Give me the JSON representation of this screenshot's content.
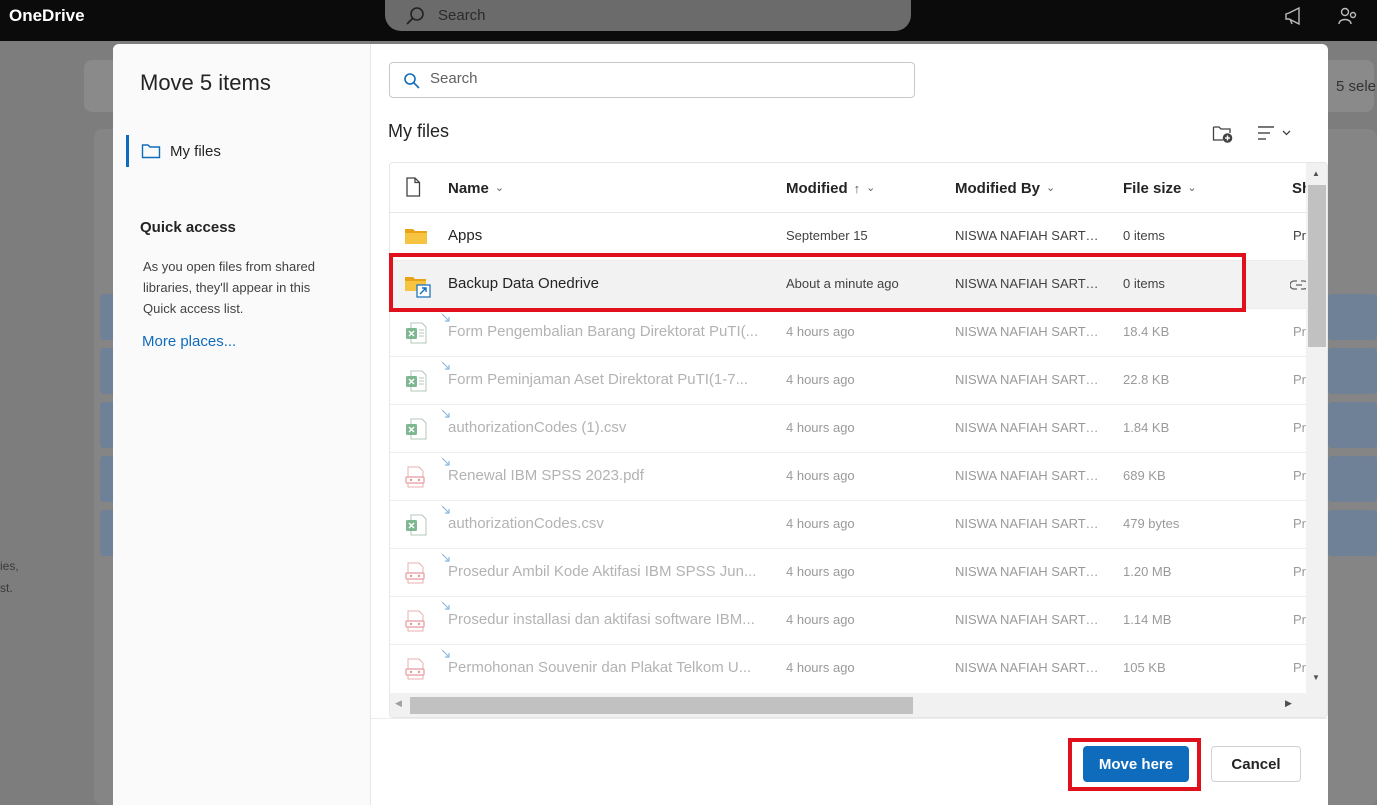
{
  "app": {
    "title": "OneDrive",
    "search_placeholder": "Search"
  },
  "background": {
    "left_text_1": "ies,",
    "left_text_2": "st.",
    "selection_text": "5 sele"
  },
  "dialog": {
    "title": "Move 5 items",
    "nav": {
      "my_files": "My files"
    },
    "quick_access": {
      "title": "Quick access",
      "description": "As you open files from shared libraries, they'll appear in this Quick access list.",
      "more_places": "More places..."
    },
    "search_placeholder": "Search",
    "folder_title": "My files",
    "columns": {
      "name": "Name",
      "modified": "Modified",
      "modified_by": "Modified By",
      "file_size": "File size",
      "sharing": "Sh"
    },
    "rows": [
      {
        "name": "Apps",
        "modified": "September 15",
        "modified_by": "NISWA NAFIAH SARTO...",
        "size": "0 items",
        "sharing": "Pr",
        "icon": "folder-icon"
      },
      {
        "name": "Backup Data Onedrive",
        "modified": "About a minute ago",
        "modified_by": "NISWA NAFIAH SARTO...",
        "size": "0 items",
        "sharing": "",
        "icon": "shared-folder-icon"
      },
      {
        "name": "Form Pengembalian Barang Direktorat PuTI(...",
        "modified": "4 hours ago",
        "modified_by": "NISWA NAFIAH SARTO...",
        "size": "18.4 KB",
        "sharing": "Pr",
        "icon": "excel-file-icon"
      },
      {
        "name": "Form Peminjaman Aset Direktorat PuTI(1-7...",
        "modified": "4 hours ago",
        "modified_by": "NISWA NAFIAH SARTO...",
        "size": "22.8 KB",
        "sharing": "Pr",
        "icon": "excel-file-icon"
      },
      {
        "name": "authorizationCodes (1).csv",
        "modified": "4 hours ago",
        "modified_by": "NISWA NAFIAH SARTO...",
        "size": "1.84 KB",
        "sharing": "Pr",
        "icon": "csv-file-icon"
      },
      {
        "name": "Renewal IBM SPSS 2023.pdf",
        "modified": "4 hours ago",
        "modified_by": "NISWA NAFIAH SARTO...",
        "size": "689 KB",
        "sharing": "Pr",
        "icon": "pdf-file-icon"
      },
      {
        "name": "authorizationCodes.csv",
        "modified": "4 hours ago",
        "modified_by": "NISWA NAFIAH SARTO...",
        "size": "479 bytes",
        "sharing": "Pr",
        "icon": "csv-file-icon"
      },
      {
        "name": "Prosedur Ambil Kode Aktifasi IBM SPSS Jun...",
        "modified": "4 hours ago",
        "modified_by": "NISWA NAFIAH SARTO...",
        "size": "1.20 MB",
        "sharing": "Pr",
        "icon": "pdf-file-icon"
      },
      {
        "name": "Prosedur installasi dan aktifasi software IBM...",
        "modified": "4 hours ago",
        "modified_by": "NISWA NAFIAH SARTO...",
        "size": "1.14 MB",
        "sharing": "Pr",
        "icon": "pdf-file-icon"
      },
      {
        "name": "Permohonan Souvenir dan Plakat Telkom U...",
        "modified": "4 hours ago",
        "modified_by": "NISWA NAFIAH SARTO...",
        "size": "105 KB",
        "sharing": "Pr",
        "icon": "pdf-file-icon"
      }
    ],
    "buttons": {
      "move_here": "Move here",
      "cancel": "Cancel"
    }
  },
  "colors": {
    "accent": "#0f6cbd",
    "annotation": "#e0101c",
    "excel": "#1d7a46",
    "pdf": "#d13438",
    "folder": "#f3c13a"
  }
}
